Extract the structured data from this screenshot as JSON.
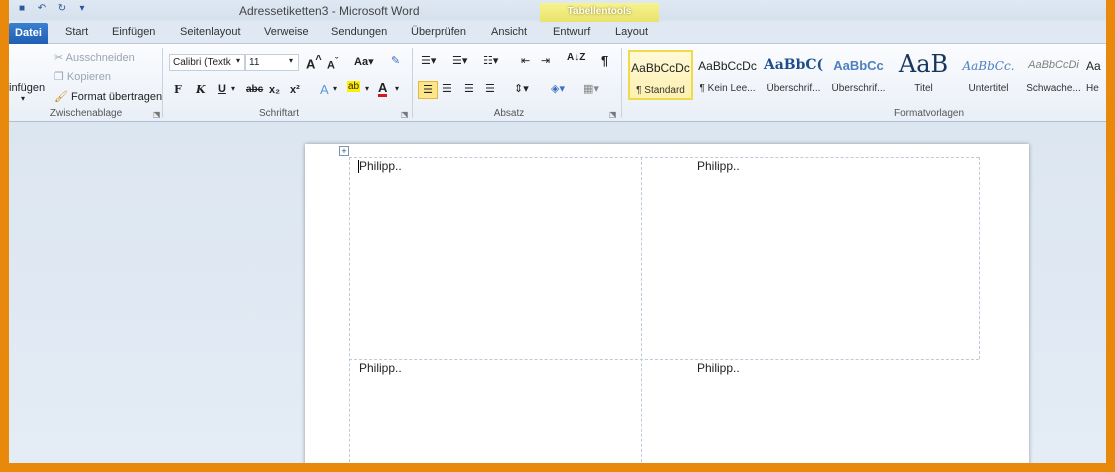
{
  "window": {
    "title": "Adressetiketten3 - Microsoft Word",
    "contextual_tab": "Tabellentools"
  },
  "tabs": [
    "Datei",
    "Start",
    "Einfügen",
    "Seitenlayout",
    "Verweise",
    "Sendungen",
    "Überprüfen",
    "Ansicht",
    "Entwurf",
    "Layout"
  ],
  "clipboard": {
    "paste": "infügen",
    "cut": "Ausschneiden",
    "copy": "Kopieren",
    "format_painter": "Format übertragen",
    "group_label": "Zwischenablage"
  },
  "font": {
    "font_name": "Calibri (Textk",
    "font_size": "11",
    "group_label": "Schriftart",
    "bold": "F",
    "italic": "K",
    "underline": "U",
    "strike": "abc",
    "subscript": "x₂",
    "superscript": "x²",
    "case": "Aa",
    "grow": "A",
    "shrink": "A"
  },
  "paragraph": {
    "group_label": "Absatz",
    "sort": "A↓Z",
    "pilcrow": "¶"
  },
  "styles": {
    "group_label": "Formatvorlagen",
    "items": [
      {
        "sample": "AaBbCcDc",
        "name": "¶ Standard"
      },
      {
        "sample": "AaBbCcDc",
        "name": "¶ Kein Lee..."
      },
      {
        "sample": "AaBbC(",
        "name": "Überschrif..."
      },
      {
        "sample": "AaBbCc",
        "name": "Überschrif..."
      },
      {
        "sample": "AaB",
        "name": "Titel"
      },
      {
        "sample": "AaBbCc.",
        "name": "Untertitel"
      },
      {
        "sample": "AaBbCcDi",
        "name": "Schwache..."
      },
      {
        "sample": "Aa",
        "name": "He"
      }
    ]
  },
  "document": {
    "labels": [
      "Philipp..",
      "Philipp..",
      "Philipp..",
      "Philipp.."
    ]
  },
  "colors": {
    "frame": "#e8890c",
    "file_tab": "#1f5fb3",
    "contextual": "#e9e26c",
    "selected_style": "#f0d94a"
  }
}
